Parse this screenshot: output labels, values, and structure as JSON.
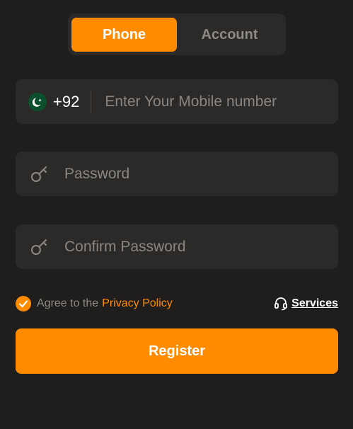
{
  "tabs": {
    "phone_label": "Phone",
    "account_label": "Account",
    "active": "Phone"
  },
  "phone_field": {
    "country_flag": "pakistan-flag-icon",
    "country_code": "+92",
    "placeholder": "Enter Your Mobile number",
    "value": ""
  },
  "password_field": {
    "icon": "key-icon",
    "placeholder": "Password",
    "value": ""
  },
  "confirm_password_field": {
    "icon": "key-icon",
    "placeholder": "Confirm Password",
    "value": ""
  },
  "agreement": {
    "checked": true,
    "text": "Agree to the",
    "link_text": "Privacy Policy"
  },
  "services": {
    "icon": "headset-icon",
    "label": "Services"
  },
  "register_button": {
    "label": "Register"
  },
  "colors": {
    "background": "#1f1e1d",
    "surface": "#2c2a28",
    "accent": "#ff8c00",
    "muted_text": "#8d8985",
    "text": "#ffffff"
  }
}
